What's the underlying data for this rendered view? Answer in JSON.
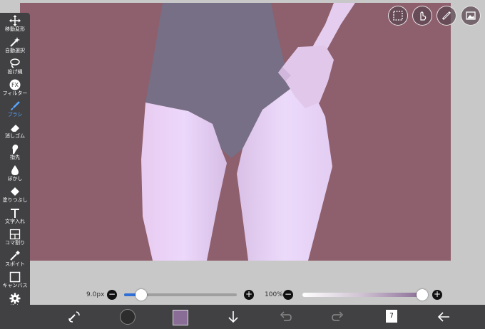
{
  "toolbar": {
    "tools": [
      {
        "label": "移動変形",
        "icon": "move-arrows-icon"
      },
      {
        "label": "自動選択",
        "icon": "magic-wand-icon"
      },
      {
        "label": "投げ縄",
        "icon": "lasso-icon"
      },
      {
        "label": "フィルター",
        "icon": "fx-icon"
      },
      {
        "label": "ブラシ",
        "icon": "brush-icon",
        "active": true
      },
      {
        "label": "消しゴム",
        "icon": "eraser-icon"
      },
      {
        "label": "指先",
        "icon": "smudge-finger-icon"
      },
      {
        "label": "ぼかし",
        "icon": "blur-drop-icon"
      },
      {
        "label": "塗りつぶし",
        "icon": "bucket-fill-icon"
      },
      {
        "label": "文字入れ",
        "icon": "text-t-icon"
      },
      {
        "label": "コマ割り",
        "icon": "panel-divide-icon"
      },
      {
        "label": "スポイト",
        "icon": "eyedropper-icon"
      },
      {
        "label": "キャンバス",
        "icon": "canvas-square-icon"
      },
      {
        "label": "設定",
        "icon": "gear-icon"
      }
    ]
  },
  "top_right_buttons": [
    "selection-icon",
    "hand-touch-icon",
    "ruler-icon",
    "material-image-icon"
  ],
  "brush_size": {
    "value_label": "9.0px",
    "level": 0.15
  },
  "opacity": {
    "value_label": "100%",
    "level": 1.0
  },
  "bottom_bar": {
    "layer_count": "7",
    "icons": [
      "transform-rotate-icon",
      "brush-preview-icon",
      "color-swatch-icon",
      "download-arrow-icon",
      "undo-icon",
      "redo-icon",
      "layers-icon",
      "back-arrow-icon"
    ]
  },
  "colors": {
    "accent": "#2f6fd8",
    "current_color": "#8a6d96",
    "canvas_background": "#8e5f6c",
    "toolbar": "#414043"
  }
}
